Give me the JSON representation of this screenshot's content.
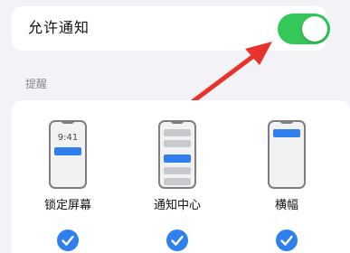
{
  "toggle": {
    "label": "允许通知",
    "on": true
  },
  "section": {
    "title": "提醒"
  },
  "alert_styles": [
    {
      "label": "锁定屏幕",
      "selected": true,
      "time": "9:41"
    },
    {
      "label": "通知中心",
      "selected": true
    },
    {
      "label": "横幅",
      "selected": true
    }
  ],
  "colors": {
    "switch_on": "#34C759",
    "accent": "#2F7FEF",
    "annotation_arrow": "#E8332A"
  },
  "icons": [
    "checkmark-icon",
    "phone-lockscreen-icon",
    "phone-notification-center-icon",
    "phone-banner-icon",
    "annotation-arrow"
  ]
}
